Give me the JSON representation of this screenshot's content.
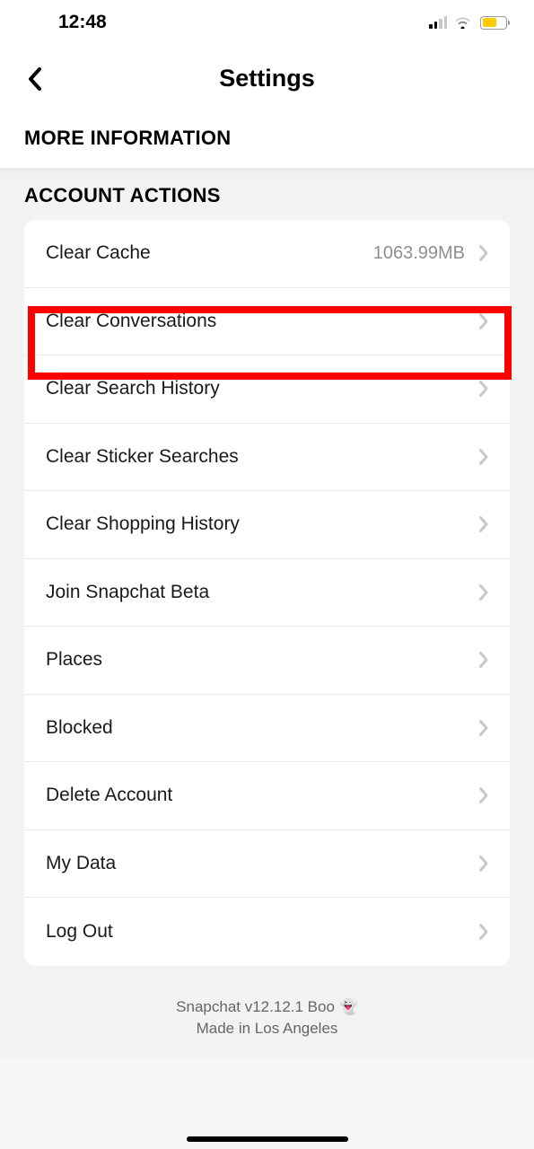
{
  "status_bar": {
    "time": "12:48"
  },
  "header": {
    "title": "Settings"
  },
  "sections": {
    "more_info_title": "MORE INFORMATION",
    "account_actions_title": "ACCOUNT ACTIONS"
  },
  "items": {
    "clear_cache": {
      "label": "Clear Cache",
      "value": "1063.99MB"
    },
    "clear_conversations": {
      "label": "Clear Conversations"
    },
    "clear_search_history": {
      "label": "Clear Search History"
    },
    "clear_sticker_searches": {
      "label": "Clear Sticker Searches"
    },
    "clear_shopping_history": {
      "label": "Clear Shopping History"
    },
    "join_beta": {
      "label": "Join Snapchat Beta"
    },
    "places": {
      "label": "Places"
    },
    "blocked": {
      "label": "Blocked"
    },
    "delete_account": {
      "label": "Delete Account"
    },
    "my_data": {
      "label": "My Data"
    },
    "log_out": {
      "label": "Log Out"
    }
  },
  "footer": {
    "line1": "Snapchat v12.12.1 Boo 👻",
    "line2": "Made in Los Angeles"
  }
}
